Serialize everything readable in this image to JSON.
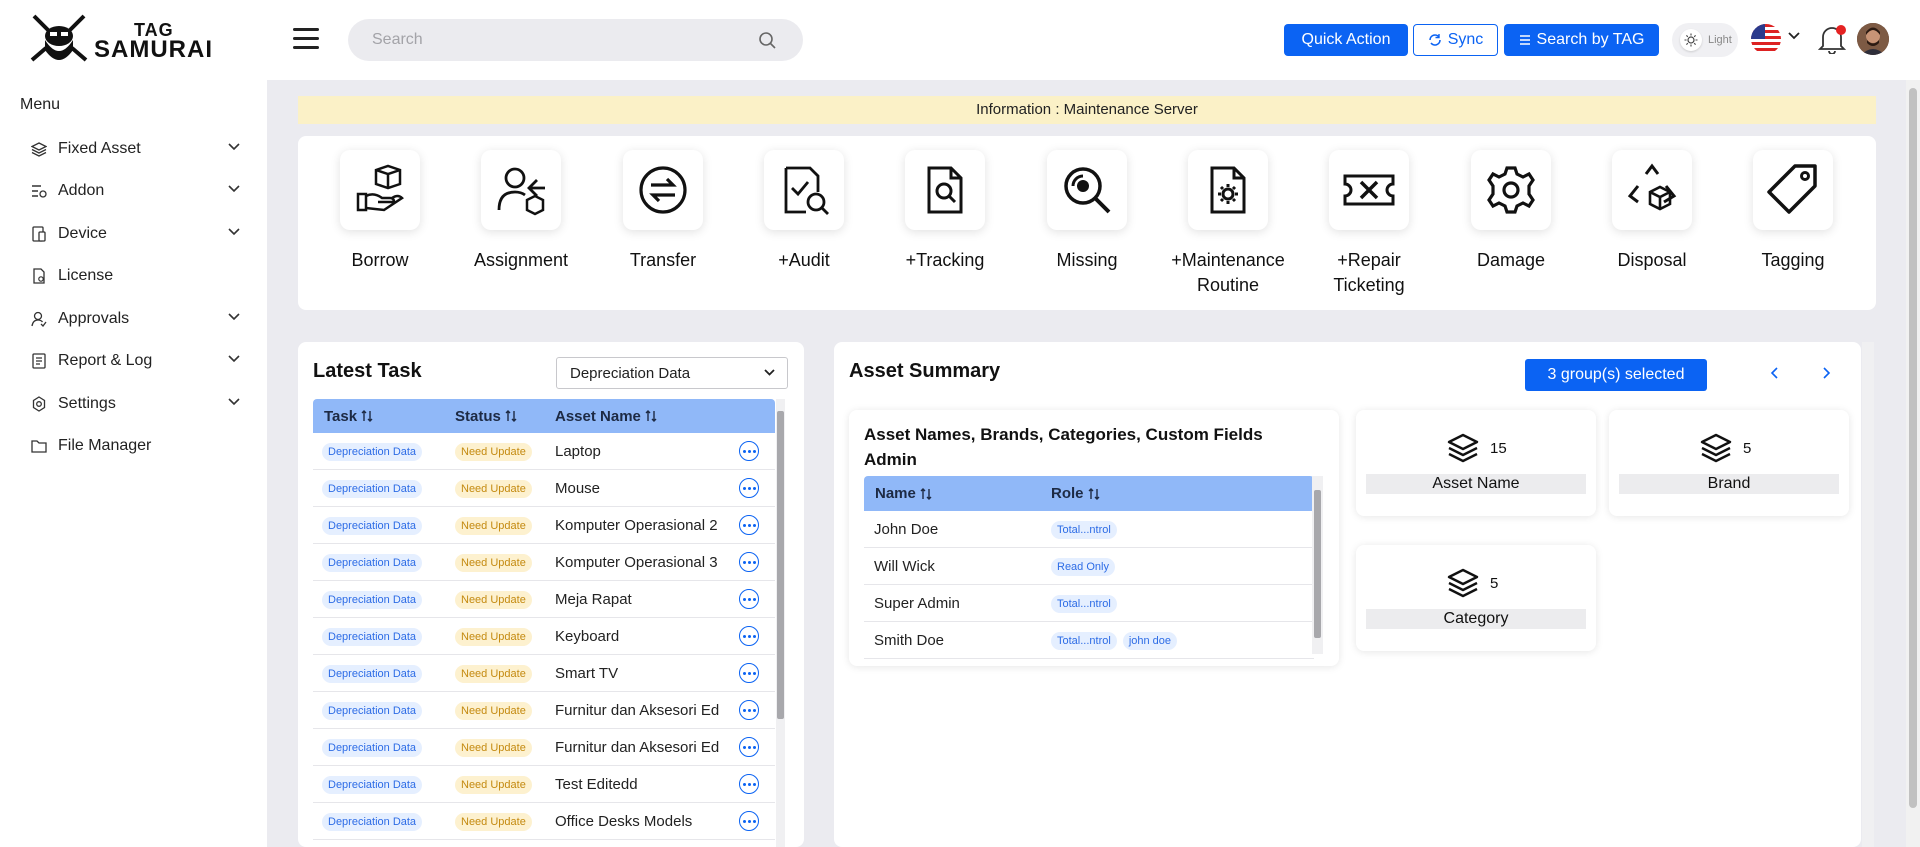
{
  "brand": {
    "line1": "TAG",
    "line2": "SAMURAI"
  },
  "search": {
    "placeholder": "Search"
  },
  "header": {
    "quick_action": "Quick Action",
    "sync": "Sync",
    "search_by_tag": "Search by TAG",
    "theme_label": "Light"
  },
  "sidebar": {
    "title": "Menu",
    "items": [
      {
        "label": "Fixed Asset",
        "icon": "layers-icon",
        "expandable": true
      },
      {
        "label": "Addon",
        "icon": "addon-icon",
        "expandable": true
      },
      {
        "label": "Device",
        "icon": "device-icon",
        "expandable": true
      },
      {
        "label": "License",
        "icon": "license-icon",
        "expandable": false
      },
      {
        "label": "Approvals",
        "icon": "approvals-icon",
        "expandable": true
      },
      {
        "label": "Report & Log",
        "icon": "report-icon",
        "expandable": true
      },
      {
        "label": "Settings",
        "icon": "settings-icon",
        "expandable": true
      },
      {
        "label": "File Manager",
        "icon": "folder-icon",
        "expandable": false
      }
    ]
  },
  "info": {
    "text": "Information : Maintenance Server"
  },
  "quick_actions": [
    {
      "label": "Borrow",
      "icon": "borrow-icon"
    },
    {
      "label": "Assignment",
      "icon": "assignment-icon"
    },
    {
      "label": "Transfer",
      "icon": "transfer-icon"
    },
    {
      "label": "+Audit",
      "icon": "audit-icon"
    },
    {
      "label": "+Tracking",
      "icon": "tracking-icon"
    },
    {
      "label": "Missing",
      "icon": "missing-icon"
    },
    {
      "label": "+Maintenance Routine",
      "icon": "maintenance-icon"
    },
    {
      "label": "+Repair Ticketing",
      "icon": "repair-ticket-icon"
    },
    {
      "label": "Damage",
      "icon": "damage-icon"
    },
    {
      "label": "Disposal",
      "icon": "disposal-icon"
    },
    {
      "label": "Tagging",
      "icon": "tag-icon"
    }
  ],
  "latest_task": {
    "title": "Latest Task",
    "filter": "Depreciation Data",
    "columns": [
      "Task",
      "Status",
      "Asset Name"
    ],
    "rows": [
      {
        "task": "Depreciation Data",
        "status": "Need Update",
        "asset": "Laptop"
      },
      {
        "task": "Depreciation Data",
        "status": "Need Update",
        "asset": "Mouse"
      },
      {
        "task": "Depreciation Data",
        "status": "Need Update",
        "asset": "Komputer Operasional 2"
      },
      {
        "task": "Depreciation Data",
        "status": "Need Update",
        "asset": "Komputer Operasional 3"
      },
      {
        "task": "Depreciation Data",
        "status": "Need Update",
        "asset": "Meja Rapat"
      },
      {
        "task": "Depreciation Data",
        "status": "Need Update",
        "asset": "Keyboard"
      },
      {
        "task": "Depreciation Data",
        "status": "Need Update",
        "asset": "Smart TV"
      },
      {
        "task": "Depreciation Data",
        "status": "Need Update",
        "asset": "Furnitur dan Aksesori Ed"
      },
      {
        "task": "Depreciation Data",
        "status": "Need Update",
        "asset": "Furnitur dan Aksesori Ed"
      },
      {
        "task": "Depreciation Data",
        "status": "Need Update",
        "asset": "Test Editedd"
      },
      {
        "task": "Depreciation Data",
        "status": "Need Update",
        "asset": "Office Desks Models"
      }
    ]
  },
  "asset_summary": {
    "title": "Asset Summary",
    "group_button": "3 group(s) selected",
    "roles_card": {
      "title": "Asset Names, Brands, Categories, Custom Fields Admin",
      "columns": [
        "Name",
        "Role"
      ],
      "rows": [
        {
          "name": "John Doe",
          "roles": [
            "Total...ntrol"
          ]
        },
        {
          "name": "Will Wick",
          "roles": [
            "Read Only"
          ]
        },
        {
          "name": "Super Admin",
          "roles": [
            "Total...ntrol"
          ]
        },
        {
          "name": "Smith Doe",
          "roles": [
            "Total...ntrol",
            "john doe"
          ]
        }
      ]
    },
    "stats": [
      {
        "value": "15",
        "label": "Asset Name"
      },
      {
        "value": "5",
        "label": "Brand"
      },
      {
        "value": "5",
        "label": "Category"
      }
    ]
  },
  "colors": {
    "primary": "#0b63f3",
    "table_header": "#90b8f8",
    "info_bg": "#fbf1c7"
  }
}
